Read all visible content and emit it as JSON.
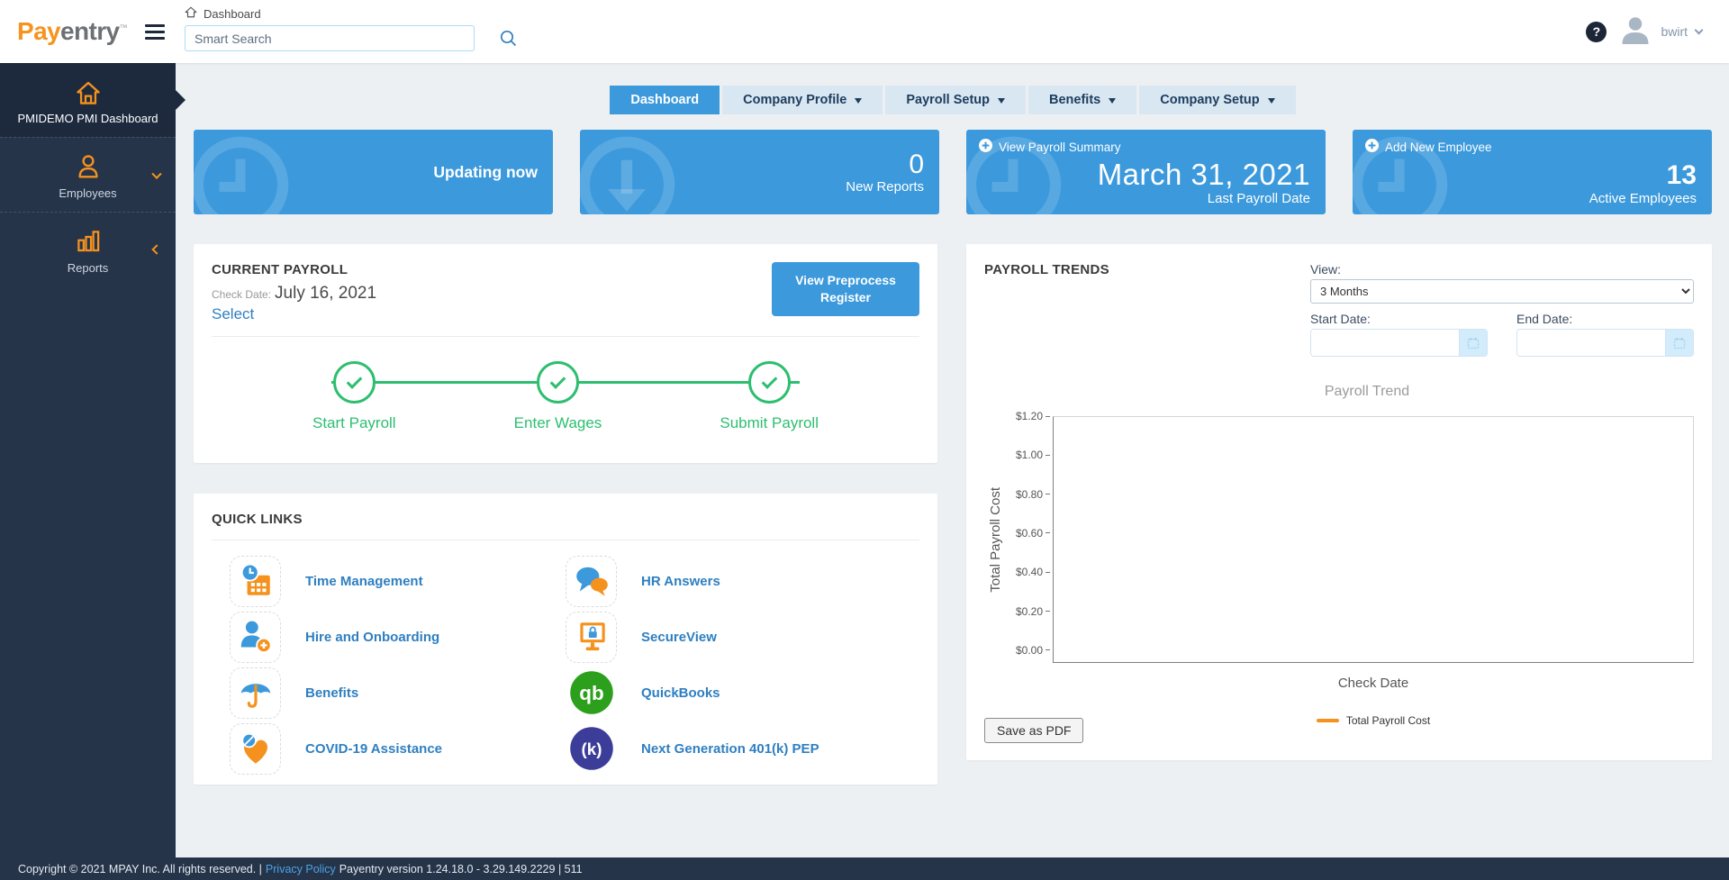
{
  "brand": {
    "pay": "Pay",
    "entry": "entry",
    "tm": "™"
  },
  "header": {
    "breadcrumb": "Dashboard",
    "search_placeholder": "Smart Search",
    "help_glyph": "?",
    "username": "bwirt"
  },
  "sidebar": {
    "items": [
      {
        "label": "PMIDEMO PMI Dashboard",
        "icon": "home-icon",
        "active": true
      },
      {
        "label": "Employees",
        "icon": "user-icon",
        "chevron": "down"
      },
      {
        "label": "Reports",
        "icon": "bar-chart-icon",
        "chevron": "left"
      }
    ]
  },
  "tabs": {
    "items": [
      {
        "label": "Dashboard",
        "active": true,
        "dropdown": false
      },
      {
        "label": "Company Profile",
        "active": false,
        "dropdown": true
      },
      {
        "label": "Payroll Setup",
        "active": false,
        "dropdown": true
      },
      {
        "label": "Benefits",
        "active": false,
        "dropdown": true
      },
      {
        "label": "Company Setup",
        "active": false,
        "dropdown": true
      }
    ]
  },
  "cards": [
    {
      "title": "Updating now",
      "icon": "clock-icon"
    },
    {
      "value": "0",
      "label": "New Reports",
      "icon": "download-icon"
    },
    {
      "link": "View Payroll Summary",
      "value": "March 31, 2021",
      "label": "Last Payroll Date",
      "icon": "clock-icon"
    },
    {
      "link": "Add New Employee",
      "value": "13",
      "label": "Active Employees",
      "icon": "clock-icon"
    }
  ],
  "current_payroll": {
    "title": "CURRENT PAYROLL",
    "check_date_label": "Check Date:",
    "check_date": "July 16, 2021",
    "select_link": "Select",
    "button": "View Preprocess Register",
    "steps": [
      {
        "label": "Start Payroll",
        "done": true
      },
      {
        "label": "Enter Wages",
        "done": true
      },
      {
        "label": "Submit Payroll",
        "done": true
      }
    ]
  },
  "quick_links": {
    "title": "QUICK LINKS",
    "items": [
      {
        "label": "Time Management",
        "icon": "time-management-icon"
      },
      {
        "label": "HR Answers",
        "icon": "hr-answers-icon"
      },
      {
        "label": "Hire and Onboarding",
        "icon": "hire-onboarding-icon"
      },
      {
        "label": "SecureView",
        "icon": "secureview-icon"
      },
      {
        "label": "Benefits",
        "icon": "benefits-umbrella-icon"
      },
      {
        "label": "QuickBooks",
        "icon": "quickbooks-icon"
      },
      {
        "label": "COVID-19 Assistance",
        "icon": "covid-assistance-icon"
      },
      {
        "label": "Next Generation 401(k) PEP",
        "icon": "401k-icon"
      }
    ]
  },
  "payroll_trends": {
    "title": "PAYROLL TRENDS",
    "view_label": "View:",
    "view_value": "3 Months",
    "start_date_label": "Start Date:",
    "end_date_label": "End Date:",
    "start_date_value": "",
    "end_date_value": "",
    "save_button": "Save as PDF"
  },
  "chart_data": {
    "type": "line",
    "title": "Payroll Trend",
    "xlabel": "Check Date",
    "ylabel": "Total Payroll Cost",
    "ylim": [
      0.0,
      1.2
    ],
    "yticks": [
      "$1.20",
      "$1.00",
      "$0.80",
      "$0.60",
      "$0.40",
      "$0.20",
      "$0.00"
    ],
    "x": [],
    "series": [
      {
        "name": "Total Payroll Cost",
        "color": "#f5921e",
        "values": []
      }
    ],
    "legend_position": "bottom",
    "grid": false
  },
  "colors": {
    "accent_blue": "#3b99dc",
    "accent_orange": "#f5921e",
    "success_green": "#2dbe70",
    "sidebar_navy": "#263449",
    "link_blue": "#2e7fc1"
  },
  "footer": {
    "copyright": "Copyright © 2021 MPAY Inc. All rights reserved. |",
    "privacy_link": "Privacy Policy",
    "version": "Payentry version 1.24.18.0 - 3.29.149.2229 | 511"
  }
}
